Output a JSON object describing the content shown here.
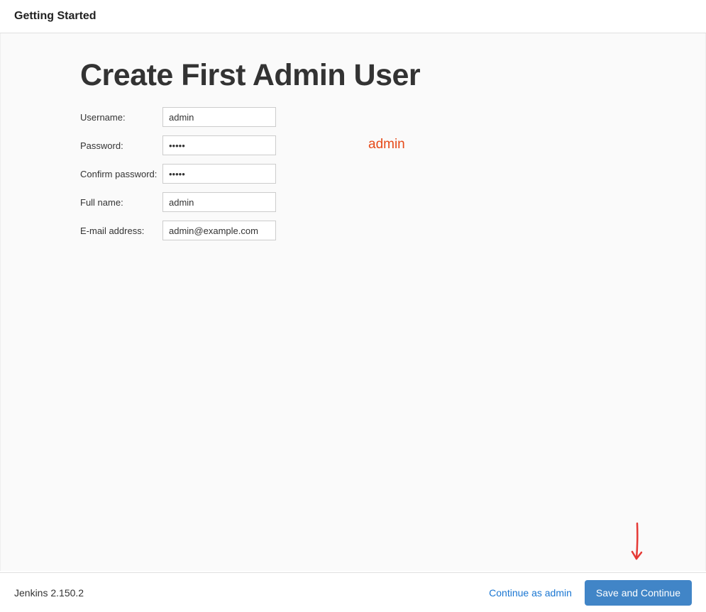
{
  "header": {
    "title": "Getting Started"
  },
  "main": {
    "heading": "Create First Admin User",
    "form": {
      "username": {
        "label": "Username:",
        "value": "admin"
      },
      "password": {
        "label": "Password:",
        "value": "•••••",
        "annotation": "admin"
      },
      "confirm_password": {
        "label": "Confirm password:",
        "value": "•••••"
      },
      "full_name": {
        "label": "Full name:",
        "value": "admin"
      },
      "email": {
        "label": "E-mail address:",
        "value": "admin@example.com"
      }
    }
  },
  "footer": {
    "version": "Jenkins 2.150.2",
    "continue_link": "Continue as admin",
    "save_button": "Save and Continue"
  }
}
